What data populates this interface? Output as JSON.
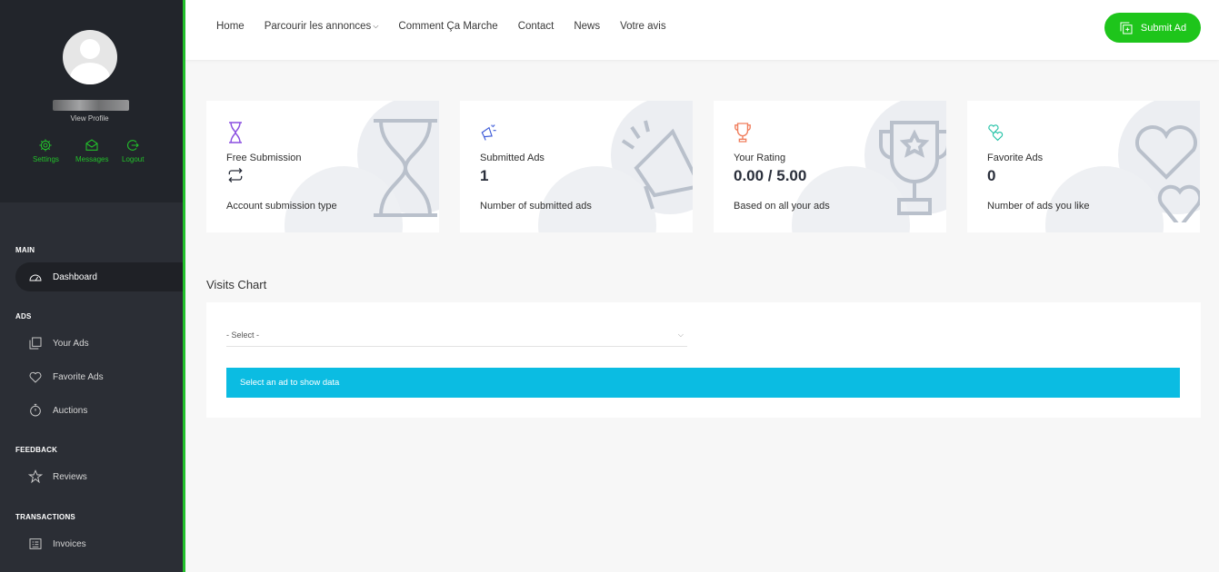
{
  "sidebar": {
    "profile": {
      "view_profile": "View Profile"
    },
    "quick_links": [
      {
        "label": "Settings",
        "icon": "gear-icon"
      },
      {
        "label": "Messages",
        "icon": "envelope-icon"
      },
      {
        "label": "Logout",
        "icon": "logout-icon"
      }
    ],
    "sections": {
      "main": "MAIN",
      "ads": "ADS",
      "feedback": "FEEDBACK",
      "transactions": "TRANSACTIONS"
    },
    "items": {
      "dashboard": "Dashboard",
      "your_ads": "Your Ads",
      "favorite_ads": "Favorite Ads",
      "auctions": "Auctions",
      "reviews": "Reviews",
      "invoices": "Invoices"
    }
  },
  "topbar": {
    "menu": [
      "Home",
      "Parcourir les annonces",
      "Comment Ça Marche",
      "Contact",
      "News",
      "Votre avis"
    ],
    "submit_label": "Submit Ad"
  },
  "stats": [
    {
      "title": "Free Submission",
      "value": "",
      "value_icon": "repeat-icon",
      "desc": "Account submission type",
      "icon": "hourglass-icon",
      "icon_color": "#8a4fe0"
    },
    {
      "title": "Submitted Ads",
      "value": "1",
      "desc": "Number of submitted ads",
      "icon": "megaphone-icon",
      "icon_color": "#3d5bd8"
    },
    {
      "title": "Your Rating",
      "value": "0.00 / 5.00",
      "desc": "Based on all your ads",
      "icon": "trophy-icon",
      "icon_color": "#f07d5c"
    },
    {
      "title": "Favorite Ads",
      "value": "0",
      "desc": "Number of ads you like",
      "icon": "hearts-icon",
      "icon_color": "#27c3a8"
    }
  ],
  "visits": {
    "title": "Visits Chart",
    "select_value": "- Select -",
    "info": "Select an ad to show data"
  },
  "colors": {
    "accent": "#22c02b",
    "sidebar_bg": "#2b2e35",
    "info_bar": "#0bbce2"
  }
}
